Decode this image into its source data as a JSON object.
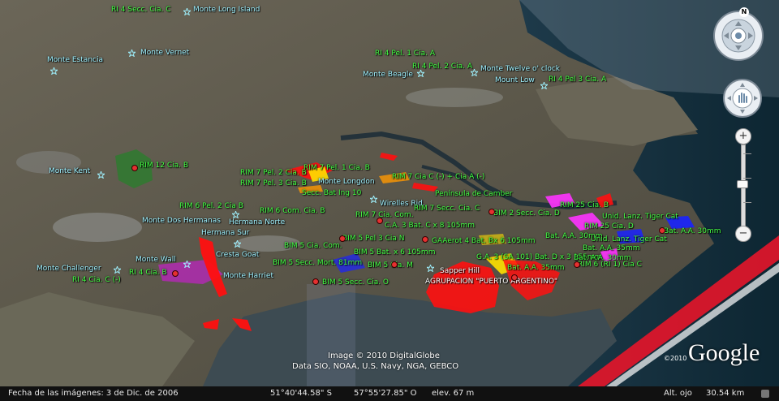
{
  "map": {
    "place_labels": [
      {
        "text": "Monte Long Island"
      },
      {
        "text": "Monte Vernet"
      },
      {
        "text": "Monte Estancia"
      },
      {
        "text": "Monte Beagle"
      },
      {
        "text": "Monte Twelve o' clock"
      },
      {
        "text": "Mount Low"
      },
      {
        "text": "Monte Kent"
      },
      {
        "text": "Monte Longdon"
      },
      {
        "text": "Wirelles Rid."
      },
      {
        "text": "Península de Camber"
      },
      {
        "text": "Monte Dos Hermanas"
      },
      {
        "text": "Hermana Norte"
      },
      {
        "text": "Hermana Sur"
      },
      {
        "text": "Cresta Goat"
      },
      {
        "text": "Monte Wall"
      },
      {
        "text": "Monte Challenger"
      },
      {
        "text": "Monte Harriet"
      },
      {
        "text": "Sapper Hill"
      }
    ],
    "unit_labels": [
      {
        "text": "RI 4 Secc. Cia. C"
      },
      {
        "text": "RI 4 Pel. 1 Cia. A"
      },
      {
        "text": "RI 4 Pel. 2 Cia. A"
      },
      {
        "text": "RI 4 Pel 3 Cia. A"
      },
      {
        "text": "RIM 12 Cia. B"
      },
      {
        "text": "RIM 7 Pel. 2 Cia. B"
      },
      {
        "text": "RIM 7 Pel. 1 Cia. B"
      },
      {
        "text": "RIM 7 Pel. 3 Cia. B"
      },
      {
        "text": "RIM 7 Cia C (-) + Cia A (-)"
      },
      {
        "text": "Secc. Bat Ing 10"
      },
      {
        "text": "RIM 6 Pel. 2 Cia B"
      },
      {
        "text": "RIM 6 Com. Cia. B"
      },
      {
        "text": "RIM 7 Cia. Com."
      },
      {
        "text": "RIM 7 Secc. Cia. C"
      },
      {
        "text": "BIM 2 Secc. Cia. D"
      },
      {
        "text": "RIM 25 Cia. B"
      },
      {
        "text": "Unid. Lanz. Tiger Cat"
      },
      {
        "text": "C.A. 3 Bat. C x 8 105mm"
      },
      {
        "text": "RIM 25 Cia. D"
      },
      {
        "text": "Bat. A.A. 30mm"
      },
      {
        "text": "Bat. A.A. 30mm"
      },
      {
        "text": "Unid. Lanz. Tiger Cat"
      },
      {
        "text": "Bat. A.A. 35mm"
      },
      {
        "text": "BIM 5 Cia. Com."
      },
      {
        "text": "BIM 5 Pel 3 Cia N"
      },
      {
        "text": "GAAerot 4 Bat. Bx 6 105mm"
      },
      {
        "text": "BIM 5 Bat. x 6 105mm"
      },
      {
        "text": "G.A. 3 (SA 101) Bat. D x 3 155mm"
      },
      {
        "text": "BIM 5 Secc. Mort. 81mm"
      },
      {
        "text": "BIM 5 Cia. M"
      },
      {
        "text": "Bat. A.A. 35mm"
      },
      {
        "text": "RIM 6 (RI 1) Cia C"
      },
      {
        "text": "BIM 5 Secc. Cia. O"
      },
      {
        "text": "RI 4 Cia. B"
      },
      {
        "text": "RI 4 Cia. C (-)"
      },
      {
        "text": "Bat. A.A. 30mm"
      }
    ],
    "white_labels": [
      {
        "text": "AGRUPACION \"PUERTO ARGENTINO\""
      }
    ]
  },
  "credits": {
    "line1": "Image © 2010 DigitalGlobe",
    "line2": "Data SIO, NOAA, U.S. Navy, NGA, GEBCO"
  },
  "logo": {
    "text": "Google",
    "year": "©2010"
  },
  "statusbar": {
    "imagery_date": "Fecha de las imágenes:  3 de Dic. de 2006",
    "latitude": "51°40'44.58\" S",
    "longitude": "57°55'27.85\" O",
    "elevation": "elev.   67 m",
    "eye_alt_label": "Alt. ojo",
    "eye_alt_value": "30.54 km"
  },
  "nav": {
    "north": "N",
    "zoom_in": "+",
    "zoom_out": "−"
  },
  "colors": {
    "unit_label": "#44ff44",
    "place_label": "#9ff2ff",
    "zone_red": "#ff1010",
    "zone_purple": "#b02ab0",
    "zone_green": "#2f7a2f",
    "zone_magenta": "#ff33ff",
    "zone_yellow": "#ffe000",
    "zone_blue": "#1a22ff"
  }
}
